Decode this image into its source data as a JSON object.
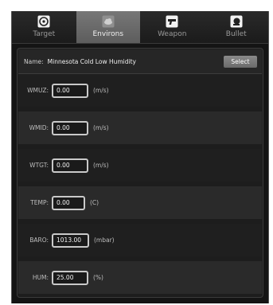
{
  "tabs": [
    {
      "label": "Target",
      "icon": "target-icon",
      "active": false
    },
    {
      "label": "Environs",
      "icon": "cloud-icon",
      "active": true
    },
    {
      "label": "Weapon",
      "icon": "pistol-icon",
      "active": false
    },
    {
      "label": "Bullet",
      "icon": "bullet-icon",
      "active": false
    }
  ],
  "name": {
    "label": "Name:",
    "value": "Minnesota Cold Low Humidity",
    "select_label": "Select"
  },
  "fields": [
    {
      "label": "WMUZ:",
      "value": "0.00",
      "unit": "(m/s)"
    },
    {
      "label": "WMID:",
      "value": "0.00",
      "unit": "(m/s)"
    },
    {
      "label": "WTGT:",
      "value": "0.00",
      "unit": "(m/s)"
    },
    {
      "label": "TEMP:",
      "value": "0.00",
      "unit": "(C)"
    },
    {
      "label": "BARO:",
      "value": "1013.00",
      "unit": "(mbar)"
    },
    {
      "label": "HUM:",
      "value": "25.00",
      "unit": "(%)"
    }
  ],
  "colors": {
    "active_tab": "#6a6a6a",
    "background": "#141414",
    "field_border": "#c9c9c9"
  }
}
